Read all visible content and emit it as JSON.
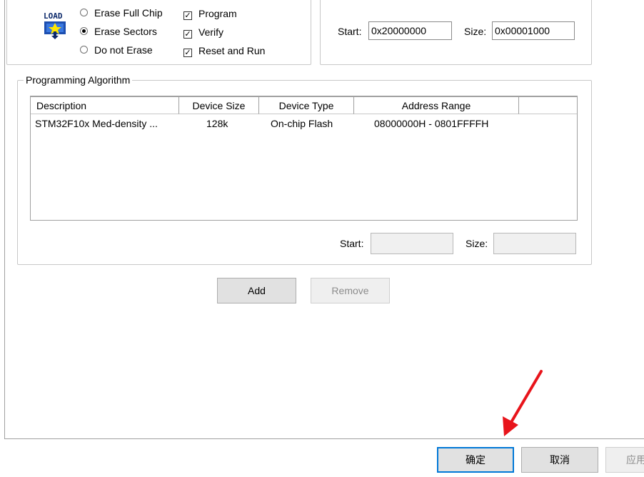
{
  "download_options": {
    "erase_options": [
      {
        "label": "Erase Full Chip",
        "selected": false
      },
      {
        "label": "Erase Sectors",
        "selected": true
      },
      {
        "label": "Do not Erase",
        "selected": false
      }
    ],
    "checks": [
      {
        "label": "Program",
        "checked": true
      },
      {
        "label": "Verify",
        "checked": true
      },
      {
        "label": "Reset and Run",
        "checked": true
      }
    ],
    "icon": "load-icon",
    "icon_text": "LOAD"
  },
  "ram_for_algorithm": {
    "start_label": "Start:",
    "start_value": "0x20000000",
    "size_label": "Size:",
    "size_value": "0x00001000"
  },
  "programming_algorithm": {
    "title": "Programming Algorithm",
    "columns": [
      "Description",
      "Device Size",
      "Device Type",
      "Address Range"
    ],
    "rows": [
      {
        "description": "STM32F10x Med-density ...",
        "device_size": "128k",
        "device_type": "On-chip Flash",
        "address_range": "08000000H - 0801FFFFH"
      }
    ],
    "start_label": "Start:",
    "start_value": "",
    "size_label": "Size:",
    "size_value": ""
  },
  "actions": {
    "add_label": "Add",
    "remove_label": "Remove"
  },
  "dialog_buttons": {
    "ok_label": "确定",
    "cancel_label": "取消",
    "apply_label": "应用"
  },
  "colors": {
    "accent": "#0078d7",
    "arrow": "#e8141b"
  }
}
